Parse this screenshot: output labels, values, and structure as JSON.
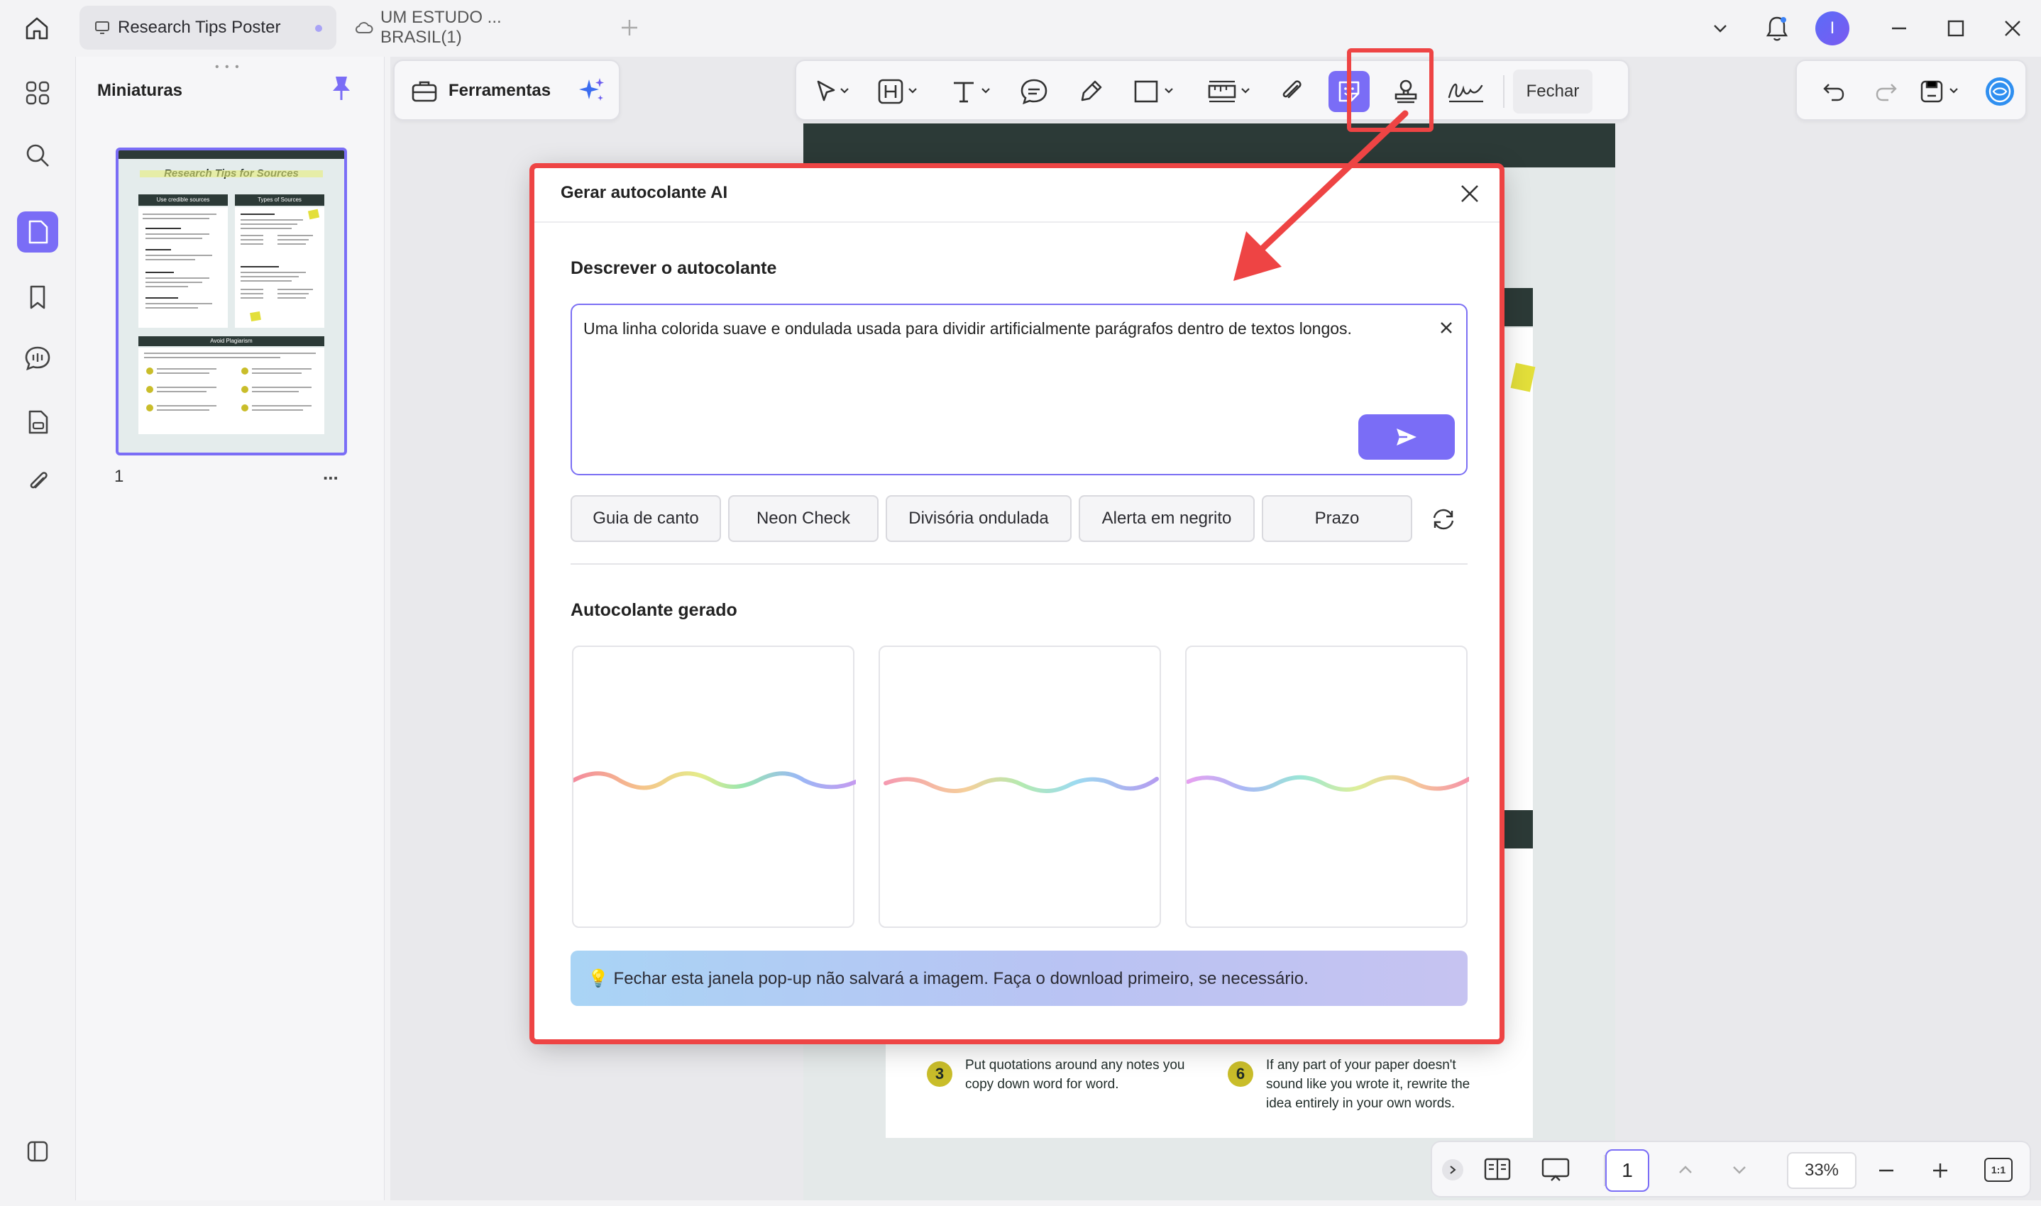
{
  "titlebar": {
    "tabs": [
      {
        "label": "Research Tips Poster",
        "active": true
      },
      {
        "label": "UM ESTUDO ... BRASIL(1)",
        "active": false
      }
    ],
    "avatar_initial": "I"
  },
  "thumbnails": {
    "title": "Miniaturas",
    "page_number": "1",
    "more": "...",
    "preview": {
      "title": "Research Tips for Sources",
      "col1_header": "Use credible sources",
      "col2_header": "Types of Sources",
      "footer_header": "Avoid Plagiarism"
    }
  },
  "toolbar": {
    "tools_label": "Ferramentas",
    "close_label": "Fechar"
  },
  "page_bottom": {
    "item3_num": "3",
    "item3_text_l1": "Put quotations around any notes you",
    "item3_text_l2": "copy down word for word.",
    "item6_num": "6",
    "item6_text_l1": "If any part of your paper doesn't",
    "item6_text_l2": "sound like you wrote it, rewrite the",
    "item6_text_l3": "idea entirely in your own words."
  },
  "dialog": {
    "title": "Gerar autocolante AI",
    "describe_label": "Descrever o autocolante",
    "description_value": "Uma linha colorida suave e ondulada usada para dividir artificialmente parágrafos dentro de textos longos.",
    "chips": [
      "Guia de canto",
      "Neon Check",
      "Divisória ondulada",
      "Alerta em negrito",
      "Prazo"
    ],
    "generated_label": "Autocolante gerado",
    "notice": "💡 Fechar esta janela pop-up não salvará a imagem. Faça o download primeiro, se necessário.",
    "colors": {
      "accent": "#7a6df6",
      "highlight": "#ee4444"
    }
  },
  "bottombar": {
    "page_input": "1",
    "zoom": "33%",
    "fit_label": "1:1"
  }
}
